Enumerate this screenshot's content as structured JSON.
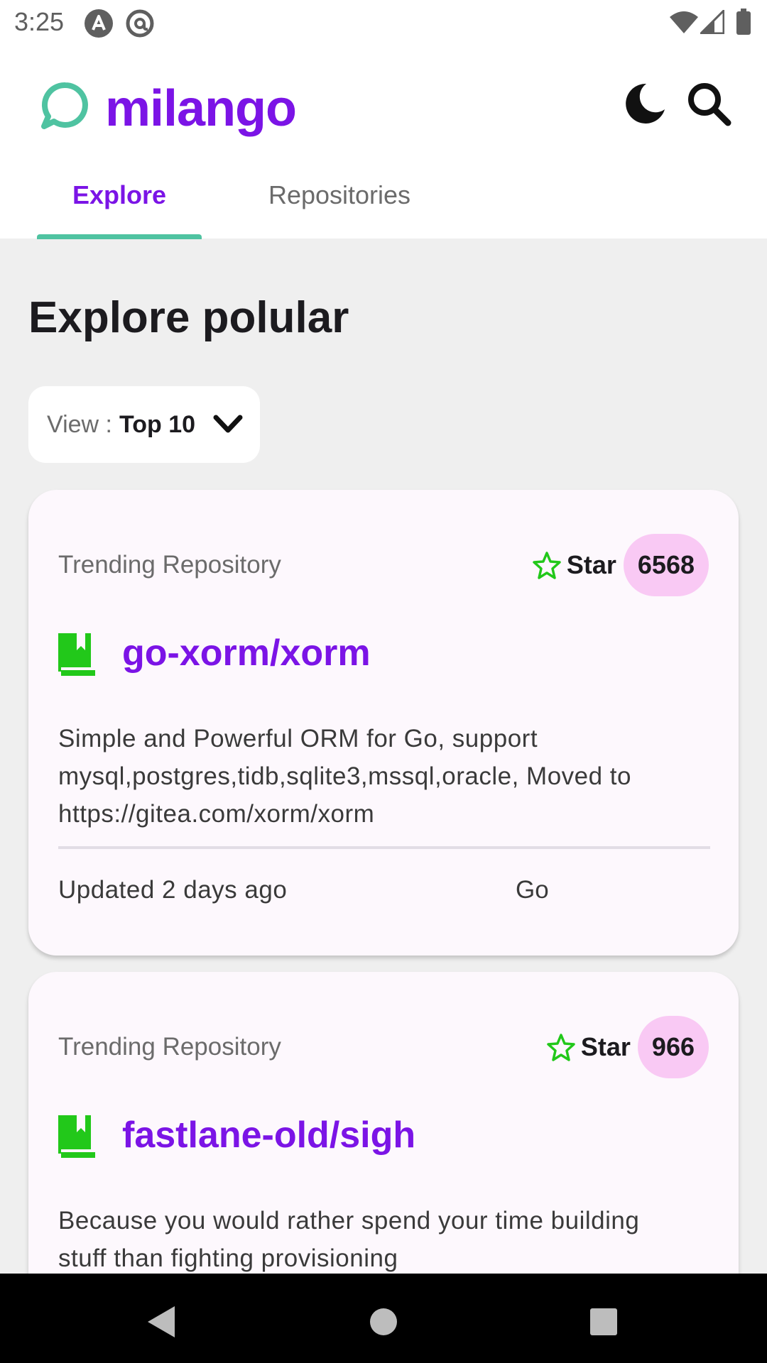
{
  "status_bar": {
    "time": "3:25",
    "icons": [
      "notification-a-icon",
      "notification-at-icon",
      "wifi-icon",
      "signal-icon",
      "battery-icon"
    ]
  },
  "header": {
    "title": "milango",
    "logo_icon": "chat-bubble-icon",
    "actions": [
      "dark-mode-moon-icon",
      "search-icon"
    ],
    "brand_color": "#7b14e6",
    "accent_color": "#4fc3a1"
  },
  "tabs": [
    {
      "label": "Explore",
      "active": true
    },
    {
      "label": "Repositories",
      "active": false
    }
  ],
  "main": {
    "title": "Explore polular",
    "view_filter": {
      "label": "View : ",
      "value": "Top 10"
    }
  },
  "repos": [
    {
      "kicker": "Trending Repository",
      "star_label": "Star",
      "stars": "6568",
      "name": "go-xorm/xorm",
      "desc_lines": [
        "Simple and Powerful ORM for Go, support",
        "mysql,postgres,tidb,sqlite3,mssql,oracle, Moved to",
        "https://gitea.com/xorm/xorm"
      ],
      "updated": "Updated 2 days ago",
      "language": "Go"
    },
    {
      "kicker": "Trending Repository",
      "star_label": "Star",
      "stars": "966",
      "name": "fastlane-old/sigh",
      "desc_lines": [
        "Because you would rather spend your time building",
        "stuff than fighting provisioning"
      ]
    }
  ],
  "nav": [
    "back-icon",
    "home-icon",
    "recents-icon"
  ]
}
